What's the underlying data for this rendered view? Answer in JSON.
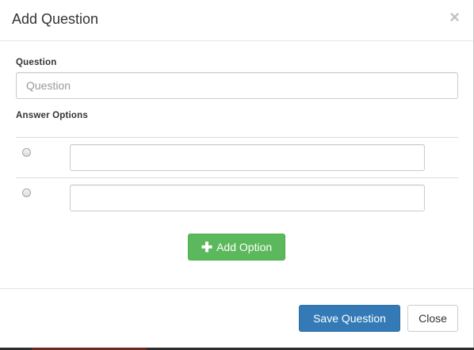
{
  "modal": {
    "title": "Add Question",
    "close_icon_glyph": "×"
  },
  "question": {
    "label": "Question",
    "placeholder": "Question",
    "value": ""
  },
  "answer_options": {
    "label": "Answer Options",
    "options": [
      {
        "selected": false,
        "value": ""
      },
      {
        "selected": false,
        "value": ""
      }
    ]
  },
  "add_option": {
    "icon": "plus-icon",
    "icon_glyph": "✚",
    "label": "Add Option"
  },
  "footer": {
    "save_label": "Save Question",
    "close_label": "Close"
  },
  "colors": {
    "primary": "#337ab7",
    "success": "#5cb85c",
    "border": "#cccccc",
    "close_x": "#c2c2c2"
  }
}
